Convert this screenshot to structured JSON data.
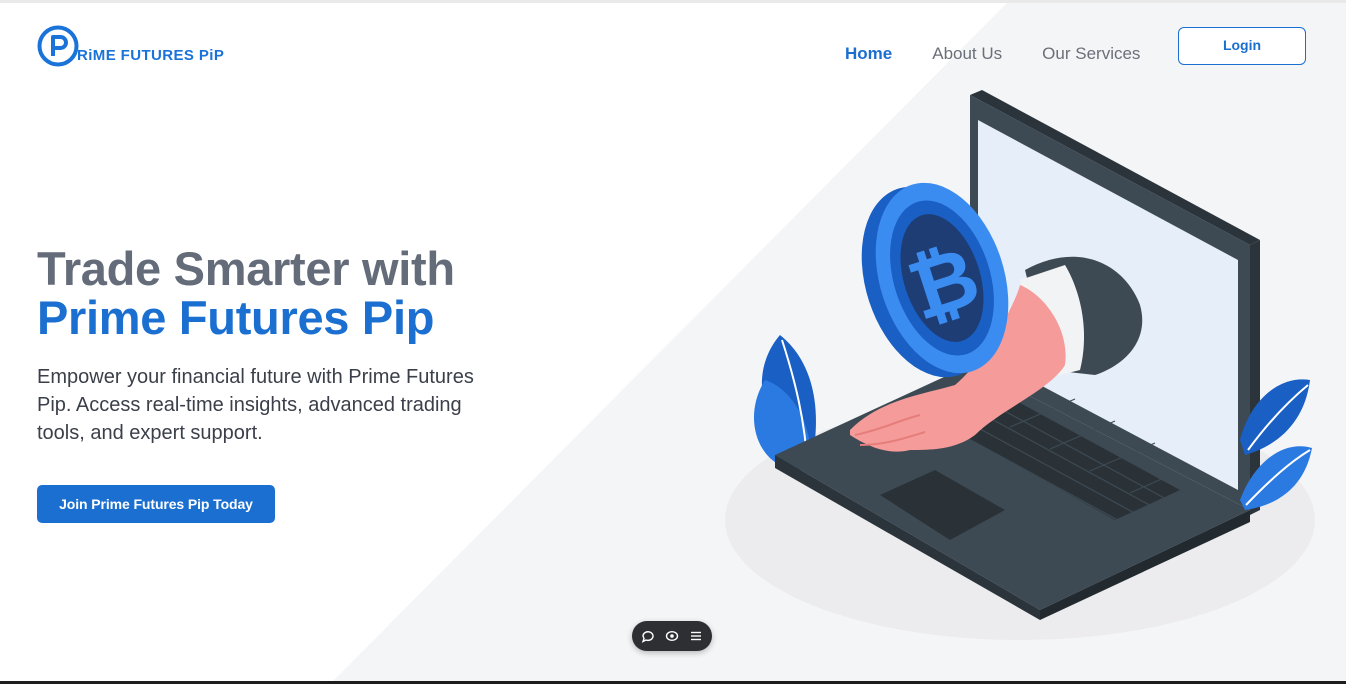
{
  "brand": {
    "name": "Prime Futures Pip",
    "logo_text": "RiME FUTURES PiP",
    "logo_letter": "P",
    "color_primary": "#1a6fd0",
    "color_heading_gray": "#646b79"
  },
  "nav": {
    "items": [
      {
        "label": "Home",
        "active": true
      },
      {
        "label": "About Us",
        "active": false
      },
      {
        "label": "Our Services",
        "active": false
      }
    ],
    "login_label": "Login"
  },
  "hero": {
    "title_line1": "Trade Smarter with",
    "title_line2": "Prime Futures Pip",
    "subtitle": "Empower your financial future with Prime Futures Pip. Access real-time insights, advanced trading tools, and expert support.",
    "cta_label": "Join Prime Futures Pip Today"
  },
  "illustration": {
    "description_icon": "laptop-hand-coin-illustration",
    "coin_symbol": "₿"
  },
  "toolbar": {
    "icons": [
      "chat-bubble-icon",
      "eye-icon",
      "menu-icon"
    ]
  }
}
